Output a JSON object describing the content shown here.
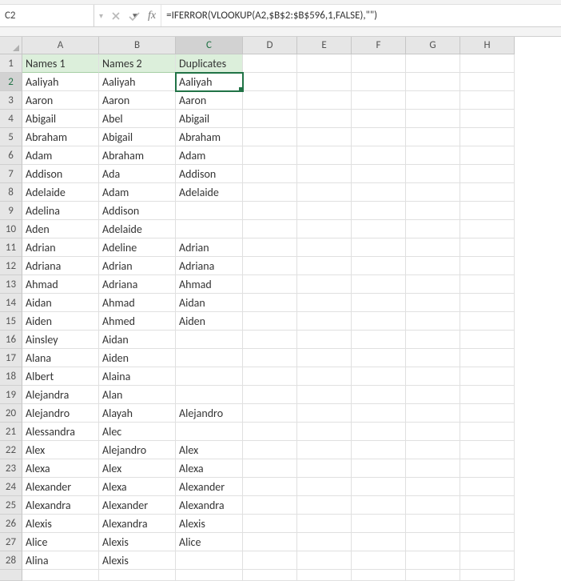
{
  "name_box": {
    "value": "C2"
  },
  "formula_bar": {
    "value": "=IFERROR(VLOOKUP(A2,$B$2:$B$596,1,FALSE),\"\")"
  },
  "columns": [
    "A",
    "B",
    "C",
    "D",
    "E",
    "F",
    "G",
    "H"
  ],
  "active_col": "C",
  "active_row": 2,
  "rows": [
    {
      "n": 1,
      "header": true,
      "A": "Names 1",
      "B": "Names 2",
      "C": "Duplicates"
    },
    {
      "n": 2,
      "A": "Aaliyah",
      "B": "Aaliyah",
      "C": "Aaliyah"
    },
    {
      "n": 3,
      "A": "Aaron",
      "B": "Aaron",
      "C": "Aaron"
    },
    {
      "n": 4,
      "A": "Abigail",
      "B": "Abel",
      "C": "Abigail"
    },
    {
      "n": 5,
      "A": "Abraham",
      "B": "Abigail",
      "C": "Abraham"
    },
    {
      "n": 6,
      "A": "Adam",
      "B": "Abraham",
      "C": "Adam"
    },
    {
      "n": 7,
      "A": "Addison",
      "B": "Ada",
      "C": "Addison"
    },
    {
      "n": 8,
      "A": "Adelaide",
      "B": "Adam",
      "C": "Adelaide"
    },
    {
      "n": 9,
      "A": "Adelina",
      "B": "Addison",
      "C": ""
    },
    {
      "n": 10,
      "A": "Aden",
      "B": "Adelaide",
      "C": ""
    },
    {
      "n": 11,
      "A": "Adrian",
      "B": "Adeline",
      "C": "Adrian"
    },
    {
      "n": 12,
      "A": "Adriana",
      "B": "Adrian",
      "C": "Adriana"
    },
    {
      "n": 13,
      "A": "Ahmad",
      "B": "Adriana",
      "C": "Ahmad"
    },
    {
      "n": 14,
      "A": "Aidan",
      "B": "Ahmad",
      "C": "Aidan"
    },
    {
      "n": 15,
      "A": "Aiden",
      "B": "Ahmed",
      "C": "Aiden"
    },
    {
      "n": 16,
      "A": "Ainsley",
      "B": "Aidan",
      "C": ""
    },
    {
      "n": 17,
      "A": "Alana",
      "B": "Aiden",
      "C": ""
    },
    {
      "n": 18,
      "A": "Albert",
      "B": "Alaina",
      "C": ""
    },
    {
      "n": 19,
      "A": "Alejandra",
      "B": "Alan",
      "C": ""
    },
    {
      "n": 20,
      "A": "Alejandro",
      "B": "Alayah",
      "C": "Alejandro"
    },
    {
      "n": 21,
      "A": "Alessandra",
      "B": "Alec",
      "C": ""
    },
    {
      "n": 22,
      "A": "Alex",
      "B": "Alejandro",
      "C": "Alex"
    },
    {
      "n": 23,
      "A": "Alexa",
      "B": "Alex",
      "C": "Alexa"
    },
    {
      "n": 24,
      "A": "Alexander",
      "B": "Alexa",
      "C": "Alexander"
    },
    {
      "n": 25,
      "A": "Alexandra",
      "B": "Alexander",
      "C": "Alexandra"
    },
    {
      "n": 26,
      "A": "Alexis",
      "B": "Alexandra",
      "C": "Alexis"
    },
    {
      "n": 27,
      "A": "Alice",
      "B": "Alexis",
      "C": "Alice"
    },
    {
      "n": 28,
      "A": "Alina",
      "B": "Alexis",
      "C": ""
    }
  ],
  "colors": {
    "accent": "#217346",
    "header_fill": "#dcefdb"
  }
}
